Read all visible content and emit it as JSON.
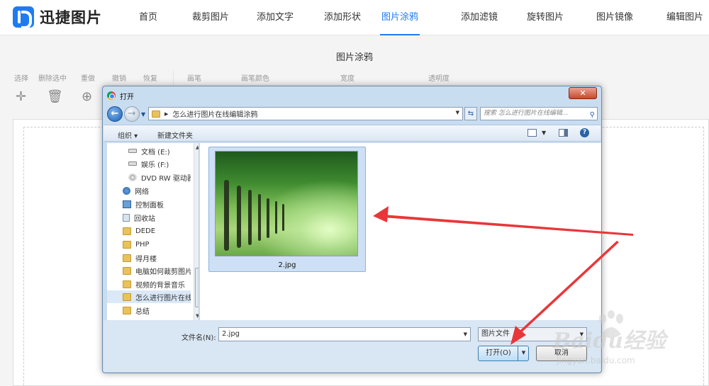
{
  "app": {
    "logo_text": "迅捷图片"
  },
  "nav": {
    "items": [
      {
        "label": "首页"
      },
      {
        "label": "裁剪图片"
      },
      {
        "label": "添加文字"
      },
      {
        "label": "添加形状"
      },
      {
        "label": "图片涂鸦",
        "active": true
      },
      {
        "label": "添加滤镜"
      },
      {
        "label": "旋转图片"
      },
      {
        "label": "图片镜像"
      },
      {
        "label": "编辑图片"
      }
    ]
  },
  "page": {
    "title": "图片涂鸦"
  },
  "toolbar": {
    "select": "选择",
    "delete": "删除选中",
    "redo": "重做",
    "undo": "撤销",
    "restore": "恢复",
    "brush": "画笔",
    "brush_color": "画笔颜色",
    "width": "宽度",
    "opacity": "透明度"
  },
  "dialog": {
    "title": "打开",
    "close": "✕",
    "address_path": "怎么进行图片在线编辑涂鸦",
    "search_placeholder": "搜索 怎么进行图片在线编辑...",
    "organize": "组织 ▾",
    "new_folder": "新建文件夹",
    "help": "?",
    "tree": [
      {
        "label": "文档 (E:)",
        "icon": "drive-icon"
      },
      {
        "label": "娱乐 (F:)",
        "icon": "drive-icon"
      },
      {
        "label": "DVD RW 驱动器",
        "icon": "dvd-icon"
      },
      {
        "label": "网络",
        "icon": "network-icon"
      },
      {
        "label": "控制面板",
        "icon": "control-panel-icon"
      },
      {
        "label": "回收站",
        "icon": "recycle-bin-icon"
      },
      {
        "label": "DEDE",
        "icon": "folder-icon"
      },
      {
        "label": "PHP",
        "icon": "folder-icon"
      },
      {
        "label": "得月楼",
        "icon": "folder-icon"
      },
      {
        "label": "电脑如何裁剪图片",
        "icon": "folder-icon"
      },
      {
        "label": "视频的背景音乐",
        "icon": "folder-icon"
      },
      {
        "label": "怎么进行图片在线",
        "icon": "folder-icon",
        "selected": true
      },
      {
        "label": "总结",
        "icon": "folder-icon"
      }
    ],
    "file": {
      "name": "2.jpg"
    },
    "filename_label": "文件名(N):",
    "filename_value": "2.jpg",
    "filetype": "图片文件",
    "open_button": "打开(O)",
    "cancel_button": "取消"
  },
  "watermark": {
    "text": "Baidu经验",
    "sub": "jingyan.baidu.com"
  },
  "colors": {
    "accent": "#1f7cf0",
    "arrow": "#e8373a"
  }
}
